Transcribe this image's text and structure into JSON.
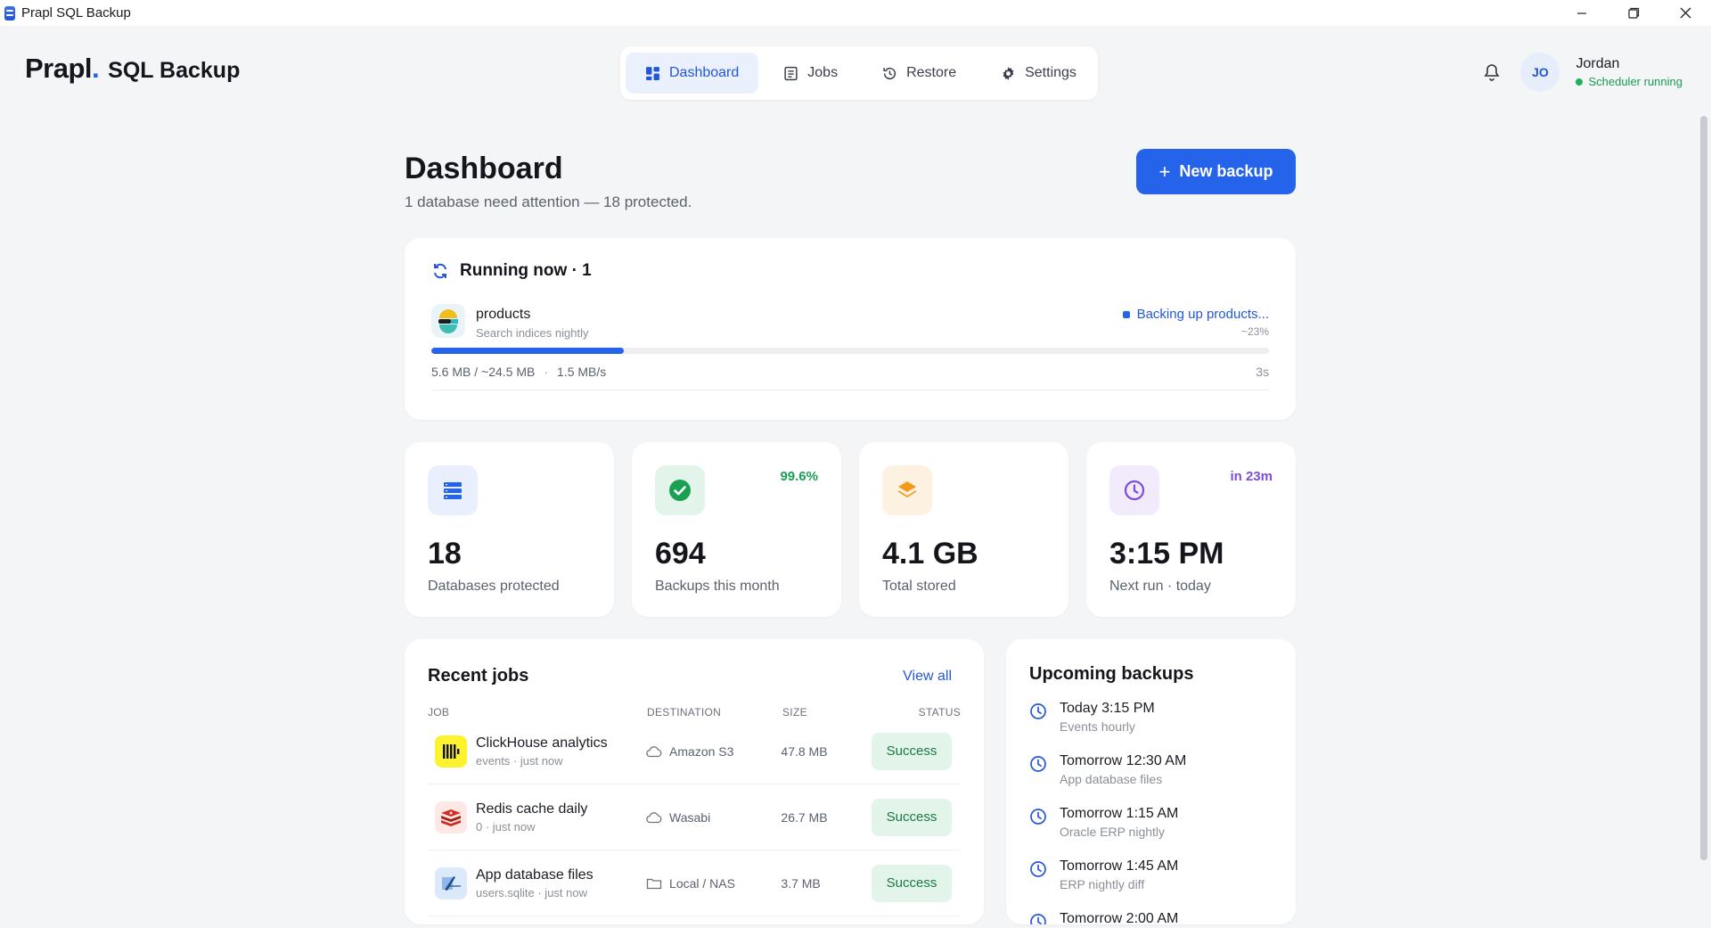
{
  "window": {
    "title": "Prapl SQL Backup"
  },
  "brand": {
    "name": "Prapl",
    "dot": ".",
    "product": "SQL Backup"
  },
  "nav": [
    {
      "label": "Dashboard",
      "icon": "dashboard-icon",
      "active": true
    },
    {
      "label": "Jobs",
      "icon": "jobs-icon",
      "active": false
    },
    {
      "label": "Restore",
      "icon": "restore-icon",
      "active": false
    },
    {
      "label": "Settings",
      "icon": "gear-icon",
      "active": false
    }
  ],
  "user": {
    "initials": "JO",
    "name": "Jordan",
    "status": "Scheduler running"
  },
  "page": {
    "title": "Dashboard",
    "subtitle": "1 database need attention — 18 protected.",
    "new_backup": "New backup"
  },
  "running": {
    "title": "Running now · 1",
    "job": {
      "name": "products",
      "desc": "Search indices nightly",
      "status": "Backing up products...",
      "pct_label": "~23%",
      "progress": 0.23,
      "transferred": "5.6 MB / ~24.5 MB",
      "rate": "1.5 MB/s",
      "elapsed": "3s"
    }
  },
  "stats": [
    {
      "value": "18",
      "label": "Databases protected",
      "badge": "",
      "icon": "database-icon",
      "color": "#2563eb",
      "bg": "#e9effd"
    },
    {
      "value": "694",
      "label": "Backups this month",
      "badge": "99.6%",
      "icon": "check-circle-icon",
      "color": "#1aa053",
      "bg": "#e3f4ea"
    },
    {
      "value": "4.1 GB",
      "label": "Total stored",
      "badge": "",
      "icon": "layers-icon",
      "color": "#f29a1a",
      "bg": "#fdf1e2"
    },
    {
      "value": "3:15 PM",
      "label": "Next run · today",
      "badge": "in 23m",
      "icon": "clock-icon",
      "color": "#7c4ddb",
      "bg": "#f1ebfb"
    }
  ],
  "recent": {
    "title": "Recent jobs",
    "view_all": "View all",
    "headers": {
      "job": "JOB",
      "destination": "DESTINATION",
      "size": "SIZE",
      "status": "STATUS"
    },
    "rows": [
      {
        "name": "ClickHouse analytics",
        "sub": "events · just now",
        "destination": "Amazon S3",
        "dest_icon": "cloud-icon",
        "size": "47.8 MB",
        "status": "Success",
        "logo": "clickhouse-logo"
      },
      {
        "name": "Redis cache daily",
        "sub": "0 · just now",
        "destination": "Wasabi",
        "dest_icon": "cloud-icon",
        "size": "26.7 MB",
        "status": "Success",
        "logo": "redis-logo"
      },
      {
        "name": "App database files",
        "sub": "users.sqlite · just now",
        "destination": "Local / NAS",
        "dest_icon": "folder-icon",
        "size": "3.7 MB",
        "status": "Success",
        "logo": "sqlite-logo"
      }
    ]
  },
  "upcoming": {
    "title": "Upcoming backups",
    "items": [
      {
        "when": "Today 3:15 PM",
        "what": "Events hourly"
      },
      {
        "when": "Tomorrow 12:30 AM",
        "what": "App database files"
      },
      {
        "when": "Tomorrow 1:15 AM",
        "what": "Oracle ERP nightly"
      },
      {
        "when": "Tomorrow 1:45 AM",
        "what": "ERP nightly diff"
      },
      {
        "when": "Tomorrow 2:00 AM",
        "what": ""
      }
    ]
  }
}
